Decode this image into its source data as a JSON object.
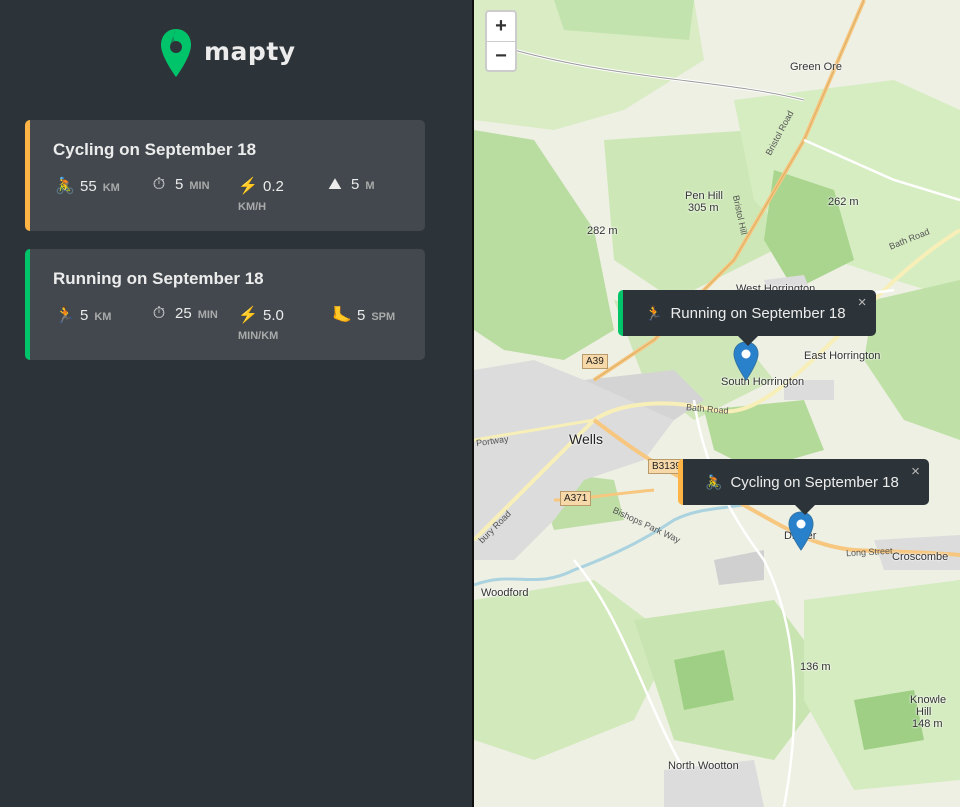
{
  "app": {
    "name": "mapty",
    "brand_color": "#00c46a"
  },
  "workouts": [
    {
      "type": "cycling",
      "title": "Cycling on September 18",
      "accent": "#ffb545",
      "distance": {
        "icon": "🚴",
        "value": "55",
        "unit": "KM"
      },
      "duration": {
        "icon": "⏱",
        "value": "5",
        "unit": "MIN"
      },
      "speed": {
        "icon": "⚡",
        "value": "0.2",
        "unit": "KM/H"
      },
      "elevation": {
        "icon": "⛰",
        "value": "5",
        "unit": "M"
      }
    },
    {
      "type": "running",
      "title": "Running on September 18",
      "accent": "#00c46a",
      "distance": {
        "icon": "🏃",
        "value": "5",
        "unit": "KM"
      },
      "duration": {
        "icon": "⏱",
        "value": "25",
        "unit": "MIN"
      },
      "pace": {
        "icon": "⚡",
        "value": "5.0",
        "unit": "MIN/KM"
      },
      "cadence": {
        "icon": "🦶",
        "value": "5",
        "unit": "SPM"
      }
    }
  ],
  "map": {
    "zoom_in": "+",
    "zoom_out": "−",
    "popups": {
      "running": {
        "icon": "🏃",
        "label": "Running on September 18",
        "close": "×"
      },
      "cycling": {
        "icon": "🚴",
        "label": "Cycling on September 18",
        "close": "×"
      }
    },
    "places": {
      "green_ore": "Green Ore",
      "pen_hill": "Pen Hill",
      "pen_hill_elev": "305 m",
      "elev_262": "262 m",
      "elev_282": "282 m",
      "west_horrington": "West Horrington",
      "east_horrington": "East Horrington",
      "south_horrington": "South Horrington",
      "wells": "Wells",
      "dinder": "Dinder",
      "croscombe": "Croscombe",
      "woodford": "Woodford",
      "elev_136": "136 m",
      "knowle_hill": "Knowle",
      "knowle_hill2": "Hill",
      "knowle_elev": "148 m",
      "north_wootton": "North Wootton"
    },
    "roads": {
      "bristol_road": "Bristol Road",
      "bristol_hill": "Bristol Hill",
      "bath_road": "Bath Road",
      "bath_road2": "Bath Road",
      "portway": "Portway",
      "bishops_park_way": "Bishops Park Way",
      "long_street": "Long Street",
      "glastonbury_road": "bury Road",
      "a39": "A39",
      "a371": "A371",
      "b3139": "B3139"
    }
  }
}
